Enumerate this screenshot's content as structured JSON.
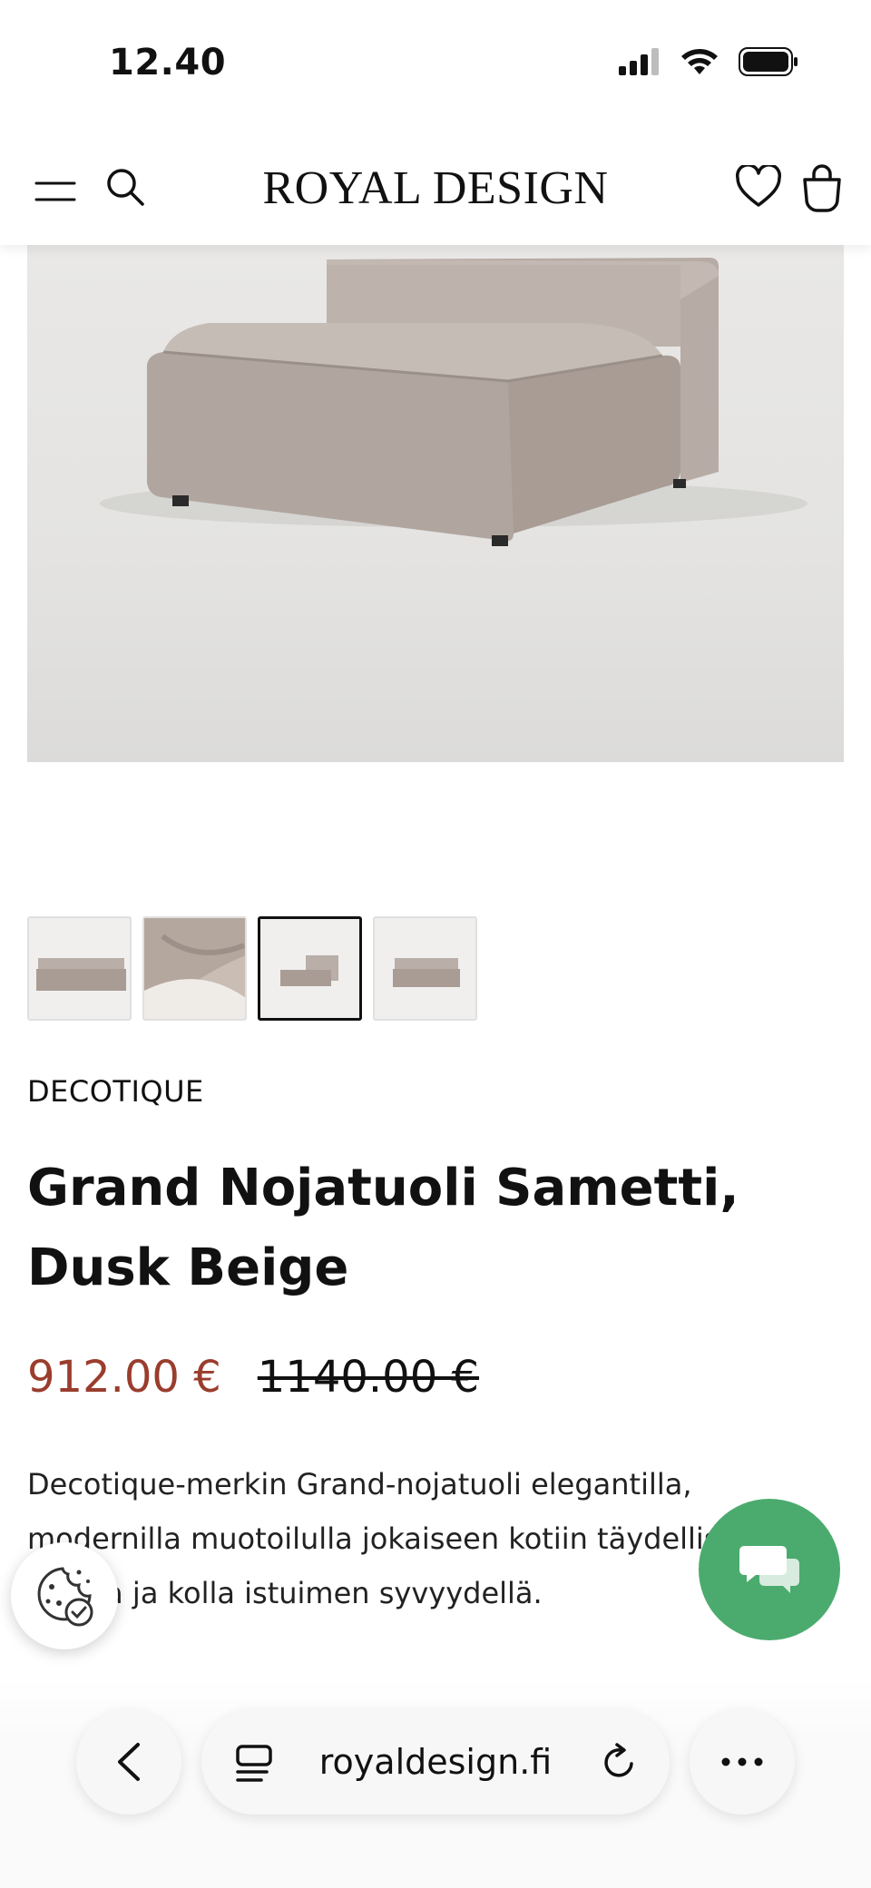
{
  "status_bar": {
    "time": "12.40"
  },
  "header": {
    "logo": "ROYAL DESIGN"
  },
  "product": {
    "brand": "DECOTIQUE",
    "title": "Grand Nojatuoli Sametti, Dusk Beige",
    "price_sale": "912.00 €",
    "price_original": "1140.00 €",
    "description": "Decotique-merkin Grand-nojatuoli elegantilla, modernilla muotoilulla jokaiseen kotiin täydellisellä nojalla ja kolla istuimen syvyydellä.",
    "thumbnail_count": 4,
    "active_thumbnail": 3
  },
  "browser": {
    "url": "royaldesign.fi"
  },
  "colors": {
    "sale": "#9a3d2d",
    "chat": "#4bab6e"
  },
  "icons": [
    "menu-icon",
    "search-icon",
    "heart-icon",
    "bag-icon",
    "cookie-icon",
    "chat-icon",
    "back-icon",
    "reader-icon",
    "reload-icon",
    "more-icon"
  ]
}
